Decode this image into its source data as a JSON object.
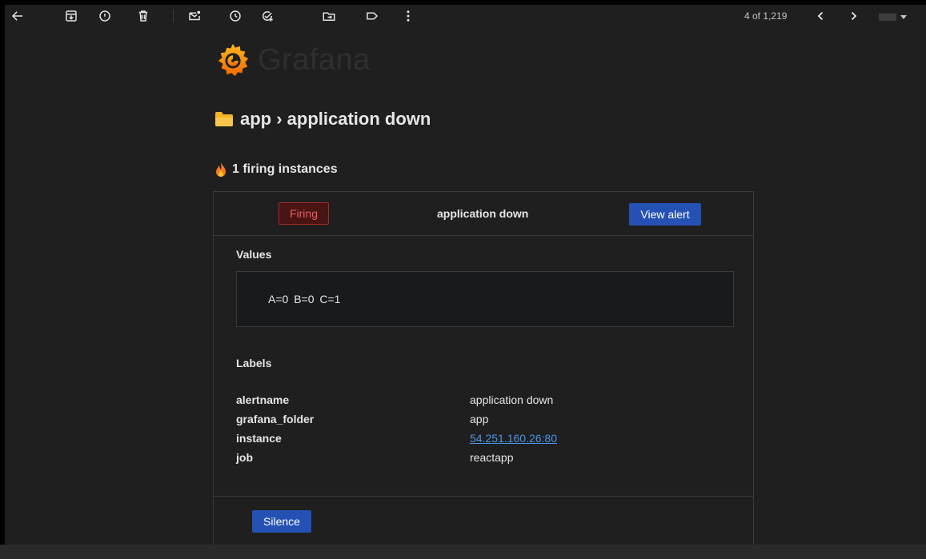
{
  "toolbar": {
    "icons": [
      "back-arrow-icon",
      "archive-icon",
      "report-spam-icon",
      "delete-icon",
      "mark-unread-icon",
      "snooze-icon",
      "add-to-tasks-icon",
      "move-to-icon",
      "label-icon",
      "more-options-icon"
    ],
    "pager_text": "4 of 1,219"
  },
  "email": {
    "logo_text": "Grafana",
    "title": "app › application down",
    "firing_heading": "1 firing instances",
    "alert": {
      "status": "Firing",
      "name": "application down",
      "view_button": "View alert",
      "values_label": "Values",
      "values_text": "A=0 B=0 C=1",
      "labels_label": "Labels",
      "labels": [
        {
          "key": "alertname",
          "value": "application down",
          "is_link": false
        },
        {
          "key": "grafana_folder",
          "value": "app",
          "is_link": false
        },
        {
          "key": "instance",
          "value": "54.251.160.26:80",
          "is_link": true
        },
        {
          "key": "job",
          "value": "reactapp",
          "is_link": false
        }
      ],
      "silence_button": "Silence"
    }
  },
  "colors": {
    "background": "#1f1f1f",
    "text": "#e6e6e6",
    "button_blue": "#2451b3",
    "firing_red": "#e85d5d",
    "link_blue": "#4b95e8",
    "grafana_orange": "#f46800",
    "grafana_yellow": "#fbb81f"
  }
}
